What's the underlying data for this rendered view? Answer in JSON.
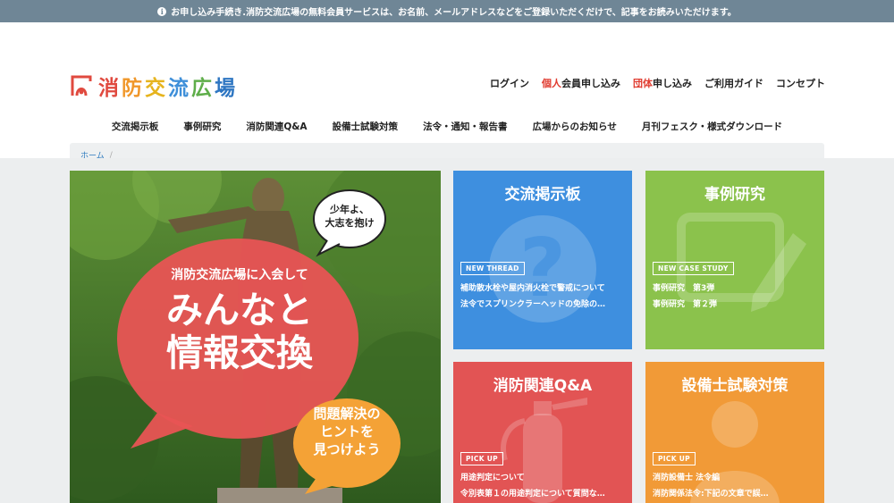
{
  "notice": "お申し込み手続き.消防交流広場の無料会員サービスは、お名前、メールアドレスなどをご登録いただくだけで、記事をお読みいただけます。",
  "logo": {
    "chars": [
      "消",
      "防",
      "交",
      "流",
      "広",
      "場"
    ]
  },
  "topnav": {
    "login": "ログイン",
    "personal_red": "個人",
    "personal_rest": "会員申し込み",
    "group_red": "団体",
    "group_rest": "申し込み",
    "guide": "ご利用ガイド",
    "concept": "コンセプト"
  },
  "mainnav": [
    "交流掲示板",
    "事例研究",
    "消防関連Q&A",
    "設備士試験対策",
    "法令・通知・報告書",
    "広場からのお知らせ",
    "月刊フェスク・様式ダウンロード"
  ],
  "breadcrumb": {
    "home": "ホーム",
    "sep": "/"
  },
  "hero": {
    "small_bubble": [
      "少年よ、",
      "大志を抱け"
    ],
    "big_bubble_top": "消防交流広場に入会して",
    "big_bubble_line1": "みんなと",
    "big_bubble_line2": "情報交換",
    "orange_bubble": [
      "問題解決の",
      "ヒントを",
      "見つけよう"
    ]
  },
  "tiles": {
    "board": {
      "title": "交流掲示板",
      "badge": "NEW THREAD",
      "lines": [
        "補助散水栓や屋内消火栓で警戒について",
        "法令でスプリンクラーヘッドの免除の…"
      ]
    },
    "case": {
      "title": "事例研究",
      "badge": "NEW CASE STUDY",
      "lines": [
        "事例研究　第3弾",
        "事例研究　第２弾"
      ]
    },
    "qa": {
      "title": "消防関連Q&A",
      "badge": "PICK UP",
      "lines": [
        "用途判定について",
        "令別表第１の用途判定について質問な…"
      ]
    },
    "exam": {
      "title": "設備士試験対策",
      "badge": "PICK UP",
      "lines": [
        "消防設備士 法令編",
        "消防関係法令:下記の文章で誤…"
      ]
    }
  },
  "colors": {
    "topbar": "#6f8696",
    "blue": "#3e8fdf",
    "green": "#8bc24c",
    "red": "#e25454",
    "orange": "#f19a37",
    "accent_red": "#e03b2f"
  }
}
